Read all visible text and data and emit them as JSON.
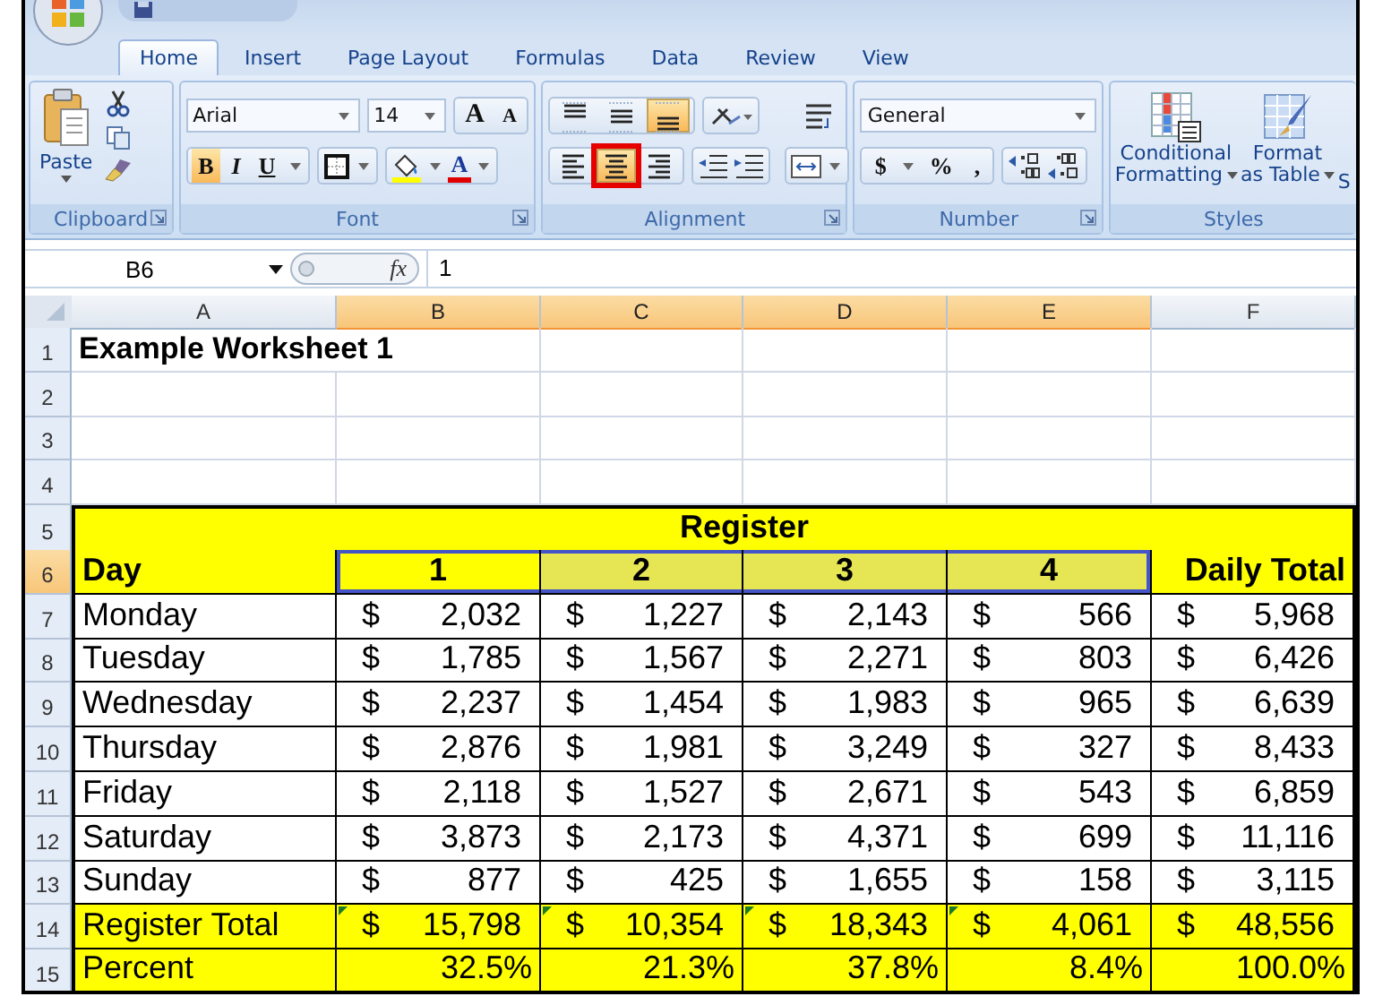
{
  "ribbon": {
    "tabs": [
      {
        "label": "Home",
        "selected": true
      },
      {
        "label": "Insert",
        "selected": false
      },
      {
        "label": "Page Layout",
        "selected": false
      },
      {
        "label": "Formulas",
        "selected": false
      },
      {
        "label": "Data",
        "selected": false
      },
      {
        "label": "Review",
        "selected": false
      },
      {
        "label": "View",
        "selected": false
      }
    ],
    "clipboard": {
      "label": "Clipboard",
      "paste": "Paste"
    },
    "font": {
      "label": "Font",
      "name": "Arial",
      "size": "14",
      "grow": "A",
      "shrink": "A",
      "styles": [
        {
          "kind": "bold",
          "text": "B",
          "selected": true
        },
        {
          "kind": "italic",
          "text": "I",
          "selected": false
        },
        {
          "kind": "underline",
          "text": "U",
          "selected": false
        }
      ],
      "color_letter": "A"
    },
    "alignment": {
      "label": "Alignment",
      "vertical": [
        {
          "kind": "top",
          "selected": false,
          "highlighted": false
        },
        {
          "kind": "middle",
          "selected": false,
          "highlighted": false
        },
        {
          "kind": "bottom",
          "selected": true,
          "highlighted": false
        }
      ],
      "horizontal": [
        {
          "kind": "left",
          "selected": false,
          "highlighted": false
        },
        {
          "kind": "center",
          "selected": true,
          "highlighted": true
        },
        {
          "kind": "right",
          "selected": false,
          "highlighted": false
        }
      ]
    },
    "number": {
      "label": "Number",
      "format": "General",
      "currency": "$",
      "percent": "%",
      "comma": ","
    },
    "styles": {
      "label": "Styles",
      "buttons": [
        {
          "kind": "conditional",
          "lines": [
            "Conditional",
            "Formatting"
          ]
        },
        {
          "kind": "table",
          "lines": [
            "Format",
            "as Table"
          ]
        }
      ],
      "cut": "S"
    }
  },
  "formula_bar": {
    "name_box": "B6",
    "fx": "fx",
    "value": "1"
  },
  "sheet": {
    "columns": [
      {
        "label": "A",
        "selected": false
      },
      {
        "label": "B",
        "selected": true
      },
      {
        "label": "C",
        "selected": true
      },
      {
        "label": "D",
        "selected": true
      },
      {
        "label": "E",
        "selected": true
      },
      {
        "label": "F",
        "selected": false
      }
    ],
    "rows": [
      {
        "header": "1",
        "selected": false,
        "kind": "title",
        "text": "Example Worksheet 1"
      },
      {
        "header": "2",
        "selected": false,
        "kind": "blank"
      },
      {
        "header": "3",
        "selected": false,
        "kind": "blank"
      },
      {
        "header": "4",
        "selected": false,
        "kind": "blank"
      },
      {
        "header": "5",
        "selected": false,
        "kind": "banner",
        "text": "Register"
      },
      {
        "header": "6",
        "selected": true,
        "kind": "header",
        "cells": [
          {
            "text": "Day",
            "selected": false,
            "active": false
          },
          {
            "text": "1",
            "selected": true,
            "active": true
          },
          {
            "text": "2",
            "selected": true,
            "active": false
          },
          {
            "text": "3",
            "selected": true,
            "active": false
          },
          {
            "text": "4",
            "selected": true,
            "active": false
          },
          {
            "text": "Daily Total",
            "selected": false,
            "active": false
          }
        ]
      },
      {
        "header": "7",
        "selected": false,
        "kind": "money",
        "label": "Monday",
        "values": [
          {
            "currency": "$",
            "amount": "2,032"
          },
          {
            "currency": "$",
            "amount": "1,227"
          },
          {
            "currency": "$",
            "amount": "2,143"
          },
          {
            "currency": "$",
            "amount": "566"
          },
          {
            "currency": "$",
            "amount": "5,968"
          }
        ]
      },
      {
        "header": "8",
        "selected": false,
        "kind": "money",
        "label": "Tuesday",
        "values": [
          {
            "currency": "$",
            "amount": "1,785"
          },
          {
            "currency": "$",
            "amount": "1,567"
          },
          {
            "currency": "$",
            "amount": "2,271"
          },
          {
            "currency": "$",
            "amount": "803"
          },
          {
            "currency": "$",
            "amount": "6,426"
          }
        ]
      },
      {
        "header": "9",
        "selected": false,
        "kind": "money",
        "label": "Wednesday",
        "values": [
          {
            "currency": "$",
            "amount": "2,237"
          },
          {
            "currency": "$",
            "amount": "1,454"
          },
          {
            "currency": "$",
            "amount": "1,983"
          },
          {
            "currency": "$",
            "amount": "965"
          },
          {
            "currency": "$",
            "amount": "6,639"
          }
        ]
      },
      {
        "header": "10",
        "selected": false,
        "kind": "money",
        "label": "Thursday",
        "values": [
          {
            "currency": "$",
            "amount": "2,876"
          },
          {
            "currency": "$",
            "amount": "1,981"
          },
          {
            "currency": "$",
            "amount": "3,249"
          },
          {
            "currency": "$",
            "amount": "327"
          },
          {
            "currency": "$",
            "amount": "8,433"
          }
        ]
      },
      {
        "header": "11",
        "selected": false,
        "kind": "money",
        "label": "Friday",
        "values": [
          {
            "currency": "$",
            "amount": "2,118"
          },
          {
            "currency": "$",
            "amount": "1,527"
          },
          {
            "currency": "$",
            "amount": "2,671"
          },
          {
            "currency": "$",
            "amount": "543"
          },
          {
            "currency": "$",
            "amount": "6,859"
          }
        ]
      },
      {
        "header": "12",
        "selected": false,
        "kind": "money",
        "label": "Saturday",
        "values": [
          {
            "currency": "$",
            "amount": "3,873"
          },
          {
            "currency": "$",
            "amount": "2,173"
          },
          {
            "currency": "$",
            "amount": "4,371"
          },
          {
            "currency": "$",
            "amount": "699"
          },
          {
            "currency": "$",
            "amount": "11,116"
          }
        ]
      },
      {
        "header": "13",
        "selected": false,
        "kind": "money",
        "label": "Sunday",
        "values": [
          {
            "currency": "$",
            "amount": "877"
          },
          {
            "currency": "$",
            "amount": "425"
          },
          {
            "currency": "$",
            "amount": "1,655"
          },
          {
            "currency": "$",
            "amount": "158"
          },
          {
            "currency": "$",
            "amount": "3,115"
          }
        ]
      },
      {
        "header": "14",
        "selected": false,
        "kind": "total",
        "label": "Register Total",
        "values": [
          {
            "currency": "$",
            "amount": "15,798",
            "flag": true
          },
          {
            "currency": "$",
            "amount": "10,354",
            "flag": true
          },
          {
            "currency": "$",
            "amount": "18,343",
            "flag": true
          },
          {
            "currency": "$",
            "amount": "4,061",
            "flag": true
          },
          {
            "currency": "$",
            "amount": "48,556",
            "flag": false
          }
        ]
      },
      {
        "header": "15",
        "selected": false,
        "kind": "percent",
        "label": "Percent",
        "values": [
          "32.5%",
          "21.3%",
          "37.8%",
          "8.4%",
          "100.0%"
        ]
      }
    ]
  }
}
